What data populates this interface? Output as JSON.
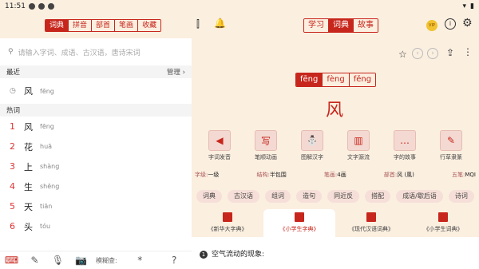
{
  "status": {
    "time": "11:51"
  },
  "top": {
    "left_tabs": [
      "词典",
      "拼音",
      "部首",
      "笔画",
      "收藏"
    ],
    "mid_tabs": [
      "学习",
      "词典",
      "故事"
    ],
    "vip": "VIP"
  },
  "search": {
    "placeholder": "请输入字词、成语、古汉语，唐诗宋词"
  },
  "recent": {
    "title": "最近",
    "manage": "管理",
    "item_char": "风",
    "item_py": "fēng"
  },
  "hot": {
    "title": "热词",
    "items": [
      {
        "n": "1",
        "c": "风",
        "p": "fēng"
      },
      {
        "n": "2",
        "c": "花",
        "p": "huā"
      },
      {
        "n": "3",
        "c": "上",
        "p": "shàng"
      },
      {
        "n": "4",
        "c": "生",
        "p": "shēng"
      },
      {
        "n": "5",
        "c": "天",
        "p": "tiān"
      },
      {
        "n": "6",
        "c": "头",
        "p": "tóu"
      }
    ]
  },
  "bottom": {
    "fuzzy": "模糊查:"
  },
  "entry": {
    "pinyin": [
      "fēng",
      "fèng",
      "fěng"
    ],
    "char": "风",
    "tiles": [
      "字词发音",
      "笔顺动画",
      "图解汉字",
      "文字源流",
      "字的故事",
      "行草隶篆"
    ],
    "tile_glyphs": [
      "◀",
      "写",
      "⛄",
      "▥",
      "…",
      "✎"
    ],
    "info": [
      {
        "k": "字级:",
        "v": "一级"
      },
      {
        "k": "结构:",
        "v": "半包围"
      },
      {
        "k": "笔画:",
        "v": "4画"
      },
      {
        "k": "部首:",
        "v": "风 (風)"
      },
      {
        "k": "五笔:",
        "v": "MQI"
      }
    ],
    "chips": [
      "词典",
      "古汉语",
      "组词",
      "造句",
      "同近反",
      "搭配",
      "成语/歇后语",
      "诗词"
    ],
    "dicts": [
      "《新华大字典》",
      "《小学生字典》",
      "《现代汉语词典》",
      "《小学生词典》"
    ],
    "def_num": "1",
    "def": "空气流动的现象:"
  }
}
